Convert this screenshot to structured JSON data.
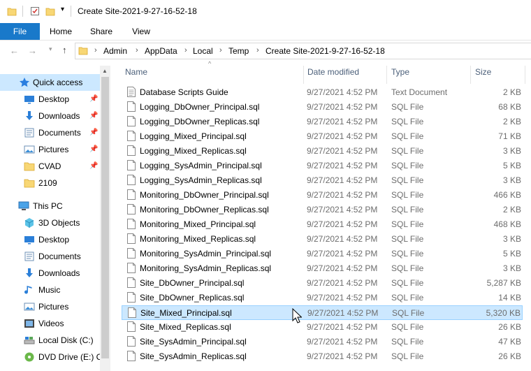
{
  "window": {
    "title": "Create Site-2021-9-27-16-52-18"
  },
  "ribbon": {
    "tabs": [
      "File",
      "Home",
      "Share",
      "View"
    ]
  },
  "address": {
    "crumbs": [
      "Admin",
      "AppData",
      "Local",
      "Temp",
      "Create Site-2021-9-27-16-52-18"
    ]
  },
  "navpane": {
    "quick_access": "Quick access",
    "quick_items": [
      {
        "label": "Desktop",
        "icon": "desktop-icon",
        "pinned": true
      },
      {
        "label": "Downloads",
        "icon": "downloads-icon",
        "pinned": true
      },
      {
        "label": "Documents",
        "icon": "documents-icon",
        "pinned": true
      },
      {
        "label": "Pictures",
        "icon": "pictures-icon",
        "pinned": true
      },
      {
        "label": "CVAD",
        "icon": "folder-icon",
        "pinned": true
      },
      {
        "label": "2109",
        "icon": "folder-icon",
        "pinned": false
      }
    ],
    "this_pc": "This PC",
    "pc_items": [
      {
        "label": "3D Objects",
        "icon": "3d-objects-icon"
      },
      {
        "label": "Desktop",
        "icon": "desktop-icon"
      },
      {
        "label": "Documents",
        "icon": "documents-icon"
      },
      {
        "label": "Downloads",
        "icon": "downloads-icon"
      },
      {
        "label": "Music",
        "icon": "music-icon"
      },
      {
        "label": "Pictures",
        "icon": "pictures-icon"
      },
      {
        "label": "Videos",
        "icon": "videos-icon"
      },
      {
        "label": "Local Disk (C:)",
        "icon": "local-disk-icon"
      },
      {
        "label": "DVD Drive (E:) CV",
        "icon": "dvd-drive-icon"
      }
    ]
  },
  "columns": {
    "name": "Name",
    "date": "Date modified",
    "type": "Type",
    "size": "Size"
  },
  "files": [
    {
      "name": "Database Scripts Guide",
      "date": "9/27/2021 4:52 PM",
      "type": "Text Document",
      "size": "2 KB",
      "icon": "text-document-icon"
    },
    {
      "name": "Logging_DbOwner_Principal.sql",
      "date": "9/27/2021 4:52 PM",
      "type": "SQL File",
      "size": "68 KB",
      "icon": "sql-file-icon"
    },
    {
      "name": "Logging_DbOwner_Replicas.sql",
      "date": "9/27/2021 4:52 PM",
      "type": "SQL File",
      "size": "2 KB",
      "icon": "sql-file-icon"
    },
    {
      "name": "Logging_Mixed_Principal.sql",
      "date": "9/27/2021 4:52 PM",
      "type": "SQL File",
      "size": "71 KB",
      "icon": "sql-file-icon"
    },
    {
      "name": "Logging_Mixed_Replicas.sql",
      "date": "9/27/2021 4:52 PM",
      "type": "SQL File",
      "size": "3 KB",
      "icon": "sql-file-icon"
    },
    {
      "name": "Logging_SysAdmin_Principal.sql",
      "date": "9/27/2021 4:52 PM",
      "type": "SQL File",
      "size": "5 KB",
      "icon": "sql-file-icon"
    },
    {
      "name": "Logging_SysAdmin_Replicas.sql",
      "date": "9/27/2021 4:52 PM",
      "type": "SQL File",
      "size": "3 KB",
      "icon": "sql-file-icon"
    },
    {
      "name": "Monitoring_DbOwner_Principal.sql",
      "date": "9/27/2021 4:52 PM",
      "type": "SQL File",
      "size": "466 KB",
      "icon": "sql-file-icon"
    },
    {
      "name": "Monitoring_DbOwner_Replicas.sql",
      "date": "9/27/2021 4:52 PM",
      "type": "SQL File",
      "size": "2 KB",
      "icon": "sql-file-icon"
    },
    {
      "name": "Monitoring_Mixed_Principal.sql",
      "date": "9/27/2021 4:52 PM",
      "type": "SQL File",
      "size": "468 KB",
      "icon": "sql-file-icon"
    },
    {
      "name": "Monitoring_Mixed_Replicas.sql",
      "date": "9/27/2021 4:52 PM",
      "type": "SQL File",
      "size": "3 KB",
      "icon": "sql-file-icon"
    },
    {
      "name": "Monitoring_SysAdmin_Principal.sql",
      "date": "9/27/2021 4:52 PM",
      "type": "SQL File",
      "size": "5 KB",
      "icon": "sql-file-icon"
    },
    {
      "name": "Monitoring_SysAdmin_Replicas.sql",
      "date": "9/27/2021 4:52 PM",
      "type": "SQL File",
      "size": "3 KB",
      "icon": "sql-file-icon"
    },
    {
      "name": "Site_DbOwner_Principal.sql",
      "date": "9/27/2021 4:52 PM",
      "type": "SQL File",
      "size": "5,287 KB",
      "icon": "sql-file-icon"
    },
    {
      "name": "Site_DbOwner_Replicas.sql",
      "date": "9/27/2021 4:52 PM",
      "type": "SQL File",
      "size": "14 KB",
      "icon": "sql-file-icon"
    },
    {
      "name": "Site_Mixed_Principal.sql",
      "date": "9/27/2021 4:52 PM",
      "type": "SQL File",
      "size": "5,320 KB",
      "icon": "sql-file-icon",
      "selected": true
    },
    {
      "name": "Site_Mixed_Replicas.sql",
      "date": "9/27/2021 4:52 PM",
      "type": "SQL File",
      "size": "26 KB",
      "icon": "sql-file-icon"
    },
    {
      "name": "Site_SysAdmin_Principal.sql",
      "date": "9/27/2021 4:52 PM",
      "type": "SQL File",
      "size": "47 KB",
      "icon": "sql-file-icon"
    },
    {
      "name": "Site_SysAdmin_Replicas.sql",
      "date": "9/27/2021 4:52 PM",
      "type": "SQL File",
      "size": "26 KB",
      "icon": "sql-file-icon"
    }
  ],
  "colors": {
    "file_tab": "#1979ca",
    "selection": "#cce8ff",
    "selection_border": "#99d1ff",
    "folder": "#f8d775",
    "header_text": "#4c607a"
  }
}
